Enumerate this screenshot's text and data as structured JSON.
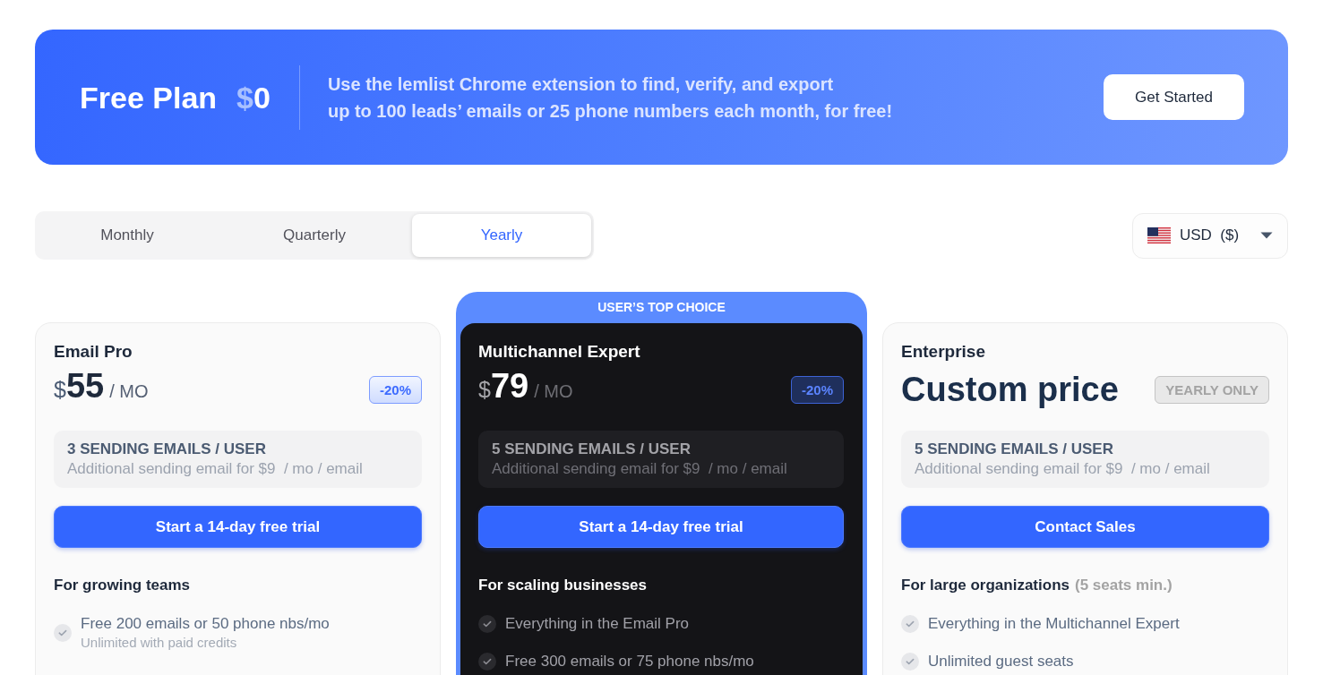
{
  "banner": {
    "title": "Free Plan",
    "price_currency": "$",
    "price_amount": "0",
    "description_lines": [
      "Use the lemlist Chrome extension to find, verify, and export",
      "up to 100 leads’ emails or 25 phone numbers each month, for free!"
    ],
    "button": "Get Started"
  },
  "billing_tabs": [
    {
      "label": "Monthly",
      "selected": false
    },
    {
      "label": "Quarterly",
      "selected": false
    },
    {
      "label": "Yearly",
      "selected": true
    }
  ],
  "currency_selector": {
    "label": "USD  ($)"
  },
  "plans": [
    {
      "name": "Email Pro",
      "featured": false,
      "price": {
        "kind": "amount",
        "currency": "$",
        "amount": "55",
        "period": "/ MO"
      },
      "badge": {
        "kind": "discount",
        "text": "-20%"
      },
      "sending": {
        "title": "3 SENDING EMAILS / USER",
        "detail": "Additional sending email for $9  / mo / email"
      },
      "button": "Start a 14-day free trial",
      "audience": "For growing teams",
      "features": [
        {
          "text": "Free 200 emails or 50 phone nbs/mo",
          "note": "Unlimited with paid credits"
        }
      ]
    },
    {
      "name": "Multichannel Expert",
      "featured": true,
      "ribbon": "USER’S TOP CHOICE",
      "price": {
        "kind": "amount",
        "currency": "$",
        "amount": "79",
        "period": "/ MO"
      },
      "badge": {
        "kind": "discount",
        "text": "-20%"
      },
      "sending": {
        "title": "5 SENDING EMAILS / USER",
        "detail": "Additional sending email for $9  / mo / email"
      },
      "button": "Start a 14-day free trial",
      "audience": "For scaling businesses",
      "features": [
        {
          "text": "Everything in the Email Pro"
        },
        {
          "text": "Free 300 emails or 75 phone nbs/mo"
        }
      ]
    },
    {
      "name": "Enterprise",
      "featured": false,
      "price": {
        "kind": "custom",
        "text": "Custom price"
      },
      "badge": {
        "kind": "notice",
        "text": "YEARLY ONLY"
      },
      "sending": {
        "title": "5 SENDING EMAILS / USER",
        "detail": "Additional sending email for $9  / mo / email"
      },
      "button": "Contact Sales",
      "audience": "For large organizations",
      "audience_note": "(5 seats min.)",
      "features": [
        {
          "text": "Everything in the Multichannel Expert"
        },
        {
          "text": "Unlimited guest seats"
        }
      ]
    }
  ]
}
